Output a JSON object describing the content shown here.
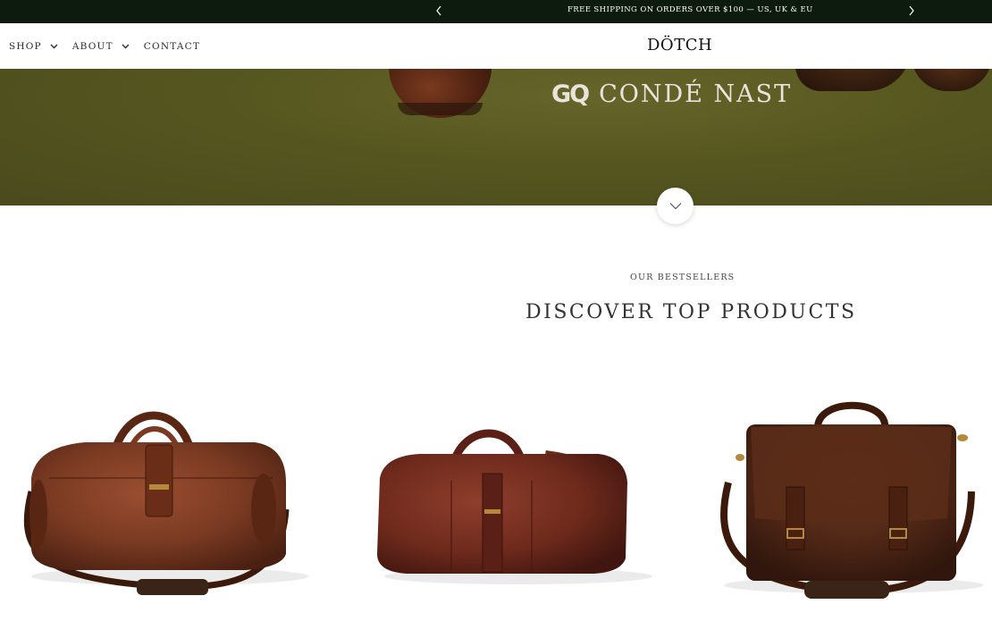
{
  "announcement": {
    "text": "FREE SHIPPING ON ORDERS OVER $100 — US, UK & EU"
  },
  "nav": {
    "items": [
      {
        "label": "SHOP",
        "has_dropdown": true
      },
      {
        "label": "ABOUT",
        "has_dropdown": true
      },
      {
        "label": "CONTACT",
        "has_dropdown": false
      }
    ]
  },
  "brand": {
    "logo": "DÖTCH"
  },
  "hero": {
    "press": {
      "gq": "GQ",
      "publisher": "CONDÉ NAST"
    }
  },
  "bestsellers": {
    "kicker": "OUR BESTSELLERS",
    "title": "DISCOVER TOP PRODUCTS"
  },
  "products": [
    {
      "image": "leather-duffle-bag-round"
    },
    {
      "image": "leather-weekender-bag"
    },
    {
      "image": "leather-messenger-bag"
    }
  ],
  "colors": {
    "announce_bg": "#0d1a0e",
    "hero_bg": "#55561f",
    "leather": "#7a3a22"
  }
}
